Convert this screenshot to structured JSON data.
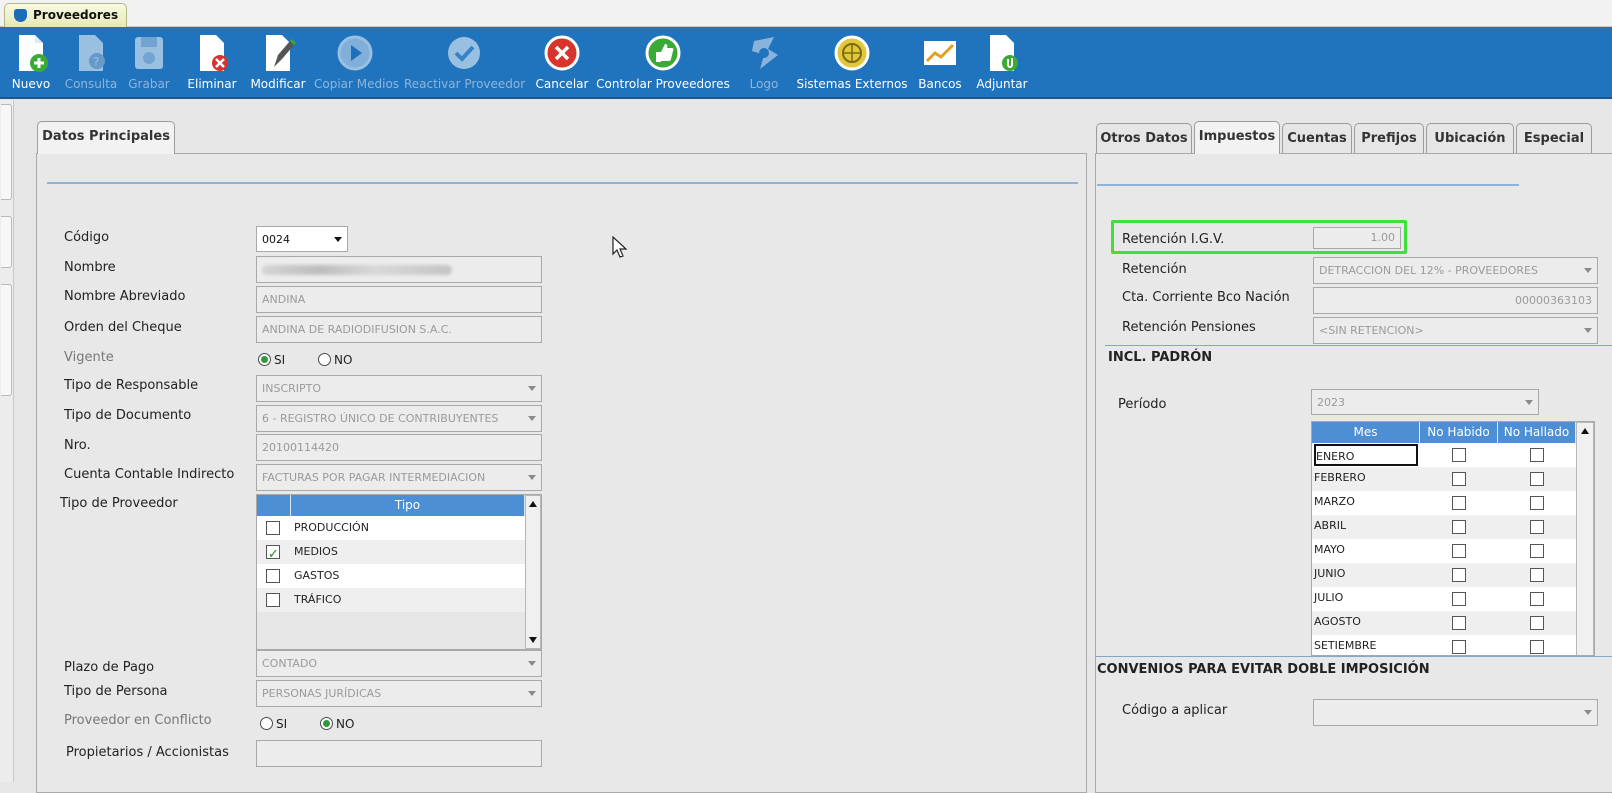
{
  "app_tab": {
    "label": "Proveedores"
  },
  "toolbar": {
    "buttons": [
      {
        "label": "Nuevo",
        "icon": "new-document-icon",
        "enabled": true
      },
      {
        "label": "Consulta",
        "icon": "query-document-icon",
        "enabled": false
      },
      {
        "label": "Grabar",
        "icon": "save-disk-icon",
        "enabled": false
      },
      {
        "label": "Eliminar",
        "icon": "delete-document-icon",
        "enabled": true
      },
      {
        "label": "Modificar",
        "icon": "edit-document-icon",
        "enabled": true
      },
      {
        "label": "Copiar Medios",
        "icon": "play-circle-icon",
        "enabled": false
      },
      {
        "label": "Reactivar Proveedor",
        "icon": "check-circle-icon",
        "enabled": false
      },
      {
        "label": "Cancelar",
        "icon": "cancel-circle-icon",
        "enabled": true
      },
      {
        "label": "Controlar Proveedores",
        "icon": "thumbs-up-icon",
        "enabled": true
      },
      {
        "label": "Logo",
        "icon": "logo-icon",
        "enabled": false
      },
      {
        "label": "Sistemas Externos",
        "icon": "external-systems-icon",
        "enabled": true
      },
      {
        "label": "Bancos",
        "icon": "chart-icon",
        "enabled": true
      },
      {
        "label": "Adjuntar",
        "icon": "attach-document-icon",
        "enabled": true
      }
    ]
  },
  "left_panel": {
    "tab": "Datos Principales",
    "fields": {
      "codigo": {
        "label": "Código",
        "value": "0024"
      },
      "nombre": {
        "label": "Nombre"
      },
      "nombre_abreviado": {
        "label": "Nombre Abreviado",
        "value": "ANDINA"
      },
      "orden_cheque": {
        "label": "Orden del Cheque",
        "value": "ANDINA DE RADIODIFUSION S.A.C."
      },
      "vigente": {
        "label": "Vigente",
        "si": "SI",
        "no": "NO",
        "selected": "SI"
      },
      "tipo_responsable": {
        "label": "Tipo de Responsable",
        "value": "INSCRIPTO"
      },
      "tipo_documento": {
        "label": "Tipo de Documento",
        "value": "6 - REGISTRO ÚNICO DE CONTRIBUYENTES"
      },
      "nro": {
        "label": "Nro.",
        "value": "20100114420"
      },
      "cuenta_contable": {
        "label": "Cuenta Contable Indirecto",
        "value": "FACTURAS POR PAGAR INTERMEDIACION"
      },
      "tipo_proveedor": {
        "label": "Tipo de Proveedor",
        "column": "Tipo",
        "rows": [
          {
            "name": "PRODUCCIÓN",
            "checked": false
          },
          {
            "name": "MEDIOS",
            "checked": true
          },
          {
            "name": "GASTOS",
            "checked": false
          },
          {
            "name": "TRÁFICO",
            "checked": false
          }
        ]
      },
      "plazo_pago": {
        "label": "Plazo de Pago",
        "value": "CONTADO"
      },
      "tipo_persona": {
        "label": "Tipo de Persona",
        "value": "PERSONAS JURÍDICAS"
      },
      "proveedor_conflicto": {
        "label": "Proveedor en Conflicto",
        "si": "SI",
        "no": "NO",
        "selected": "NO"
      },
      "propietarios": {
        "label": "Propietarios / Accionistas",
        "value": ""
      }
    }
  },
  "right_panel": {
    "tabs": [
      "Otros Datos",
      "Impuestos",
      "Cuentas",
      "Prefijos",
      "Ubicación",
      "Especial"
    ],
    "active_tab": "Impuestos",
    "retencion_igv": {
      "label": "Retención I.G.V.",
      "value": "1.00"
    },
    "retencion": {
      "label": "Retención",
      "value": "DETRACCION DEL 12% - PROVEEDORES"
    },
    "cta_corriente": {
      "label": "Cta. Corriente Bco Nación",
      "value": "00000363103"
    },
    "retencion_pensiones": {
      "label": "Retención Pensiones",
      "value": "<SIN RETENCION>"
    },
    "padron": {
      "title": "INCL. PADRÓN",
      "periodo_label": "Período",
      "periodo_value": "2023",
      "columns": [
        "Mes",
        "No Habido",
        "No Hallado"
      ],
      "months": [
        "ENERO",
        "FEBRERO",
        "MARZO",
        "ABRIL",
        "MAYO",
        "JUNIO",
        "JULIO",
        "AGOSTO",
        "SETIEMBRE"
      ]
    },
    "convenios": {
      "title": "CONVENIOS PARA EVITAR DOBLE IMPOSICIÓN",
      "codigo_label": "Código a aplicar",
      "codigo_value": ""
    }
  },
  "colors": {
    "toolbar": "#2073bd",
    "grid_header": "#4d8fd4",
    "highlight": "#3ee03a"
  }
}
